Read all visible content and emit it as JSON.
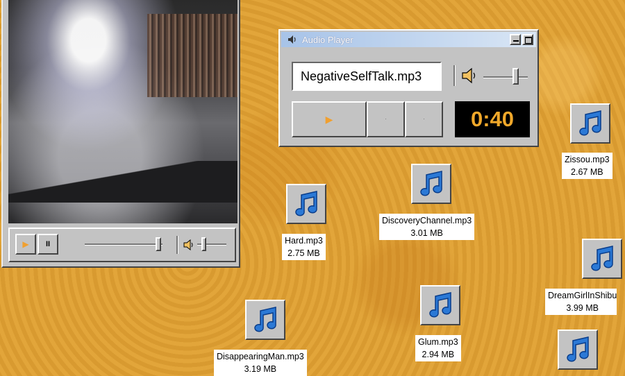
{
  "audio_player": {
    "title": "Audio Player",
    "track_name": "NegativeSelfTalk.mp3",
    "time": "0:40",
    "play_symbol": "▶",
    "button2_symbol": "·",
    "button3_symbol": "·"
  },
  "video_player": {
    "play_symbol": "▶",
    "pause_symbol": "II"
  },
  "colors": {
    "accent_orange": "#f0a030",
    "desktop": "#dfa235",
    "note_blue": "#2b79d6"
  },
  "desktop_icons": [
    {
      "icon": "music-note-icon",
      "name": "Zissou.mp3",
      "size": "2.67 MB"
    },
    {
      "icon": "music-note-icon",
      "name": "DiscoveryChannel.mp3",
      "size": "3.01 MB"
    },
    {
      "icon": "music-note-icon",
      "name": "Hard.mp3",
      "size": "2.75 MB"
    },
    {
      "icon": "music-note-icon",
      "name": "DreamGirlInShibu",
      "size": "3.99 MB"
    },
    {
      "icon": "music-note-icon",
      "name": "DisappearingMan.mp3",
      "size": "3.19 MB"
    },
    {
      "icon": "music-note-icon",
      "name": "Glum.mp3",
      "size": "2.94 MB"
    },
    {
      "icon": "music-note-icon",
      "name": "",
      "size": ""
    }
  ]
}
